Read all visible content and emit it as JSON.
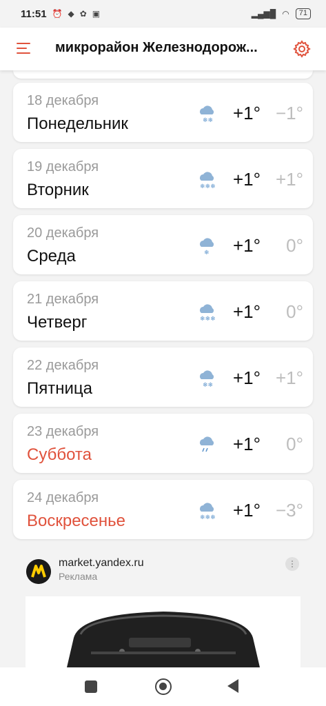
{
  "status_bar": {
    "time": "11:51",
    "left_icons": [
      "alarm-icon",
      "app-icon",
      "app-icon",
      "wb-icon"
    ],
    "battery": "71"
  },
  "header": {
    "title": "микрорайон Железнодорож...",
    "menu_icon": "hamburger-icon",
    "settings_icon": "gear-icon",
    "accent": "#e0523c"
  },
  "days": [
    {
      "date": "18 декабря",
      "weekday": "Понедельник",
      "weekend": false,
      "icon": "cloud-snow-icon",
      "day": "+1°",
      "night": "−1°"
    },
    {
      "date": "19 декабря",
      "weekday": "Вторник",
      "weekend": false,
      "icon": "cloud-heavy-snow-icon",
      "day": "+1°",
      "night": "+1°"
    },
    {
      "date": "20 декабря",
      "weekday": "Среда",
      "weekend": false,
      "icon": "cloud-snow-icon",
      "day": "+1°",
      "night": "0°"
    },
    {
      "date": "21 декабря",
      "weekday": "Четверг",
      "weekend": false,
      "icon": "cloud-heavy-snow-icon",
      "day": "+1°",
      "night": "0°"
    },
    {
      "date": "22 декабря",
      "weekday": "Пятница",
      "weekend": false,
      "icon": "cloud-snow-icon",
      "day": "+1°",
      "night": "+1°"
    },
    {
      "date": "23 декабря",
      "weekday": "Суббота",
      "weekend": true,
      "icon": "cloud-rain-icon",
      "day": "+1°",
      "night": "0°"
    },
    {
      "date": "24 декабря",
      "weekday": "Воскресенье",
      "weekend": true,
      "icon": "cloud-heavy-snow-icon",
      "day": "+1°",
      "night": "−3°"
    }
  ],
  "ad": {
    "domain": "market.yandex.ru",
    "label": "Реклама"
  }
}
